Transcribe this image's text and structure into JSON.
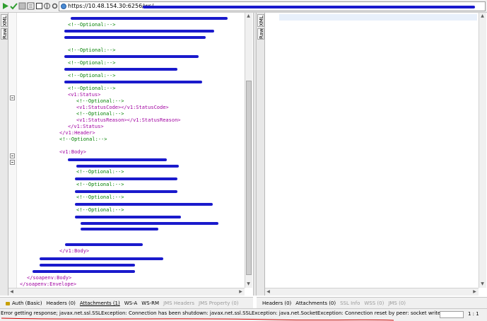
{
  "toolbar": {
    "url": "https://10.48.154.30:6256/ws/",
    "icons": [
      "play-icon",
      "green-check-icon",
      "stop-icon",
      "options-icon",
      "square-icon",
      "ws-icon",
      "settings-icon"
    ]
  },
  "left_panel": {
    "side_tabs": [
      "XML",
      "Raw"
    ],
    "code_lines": [
      {
        "text": "<!--Optional:-->",
        "kind": "comment"
      },
      {
        "text": "<!--Optional:-->",
        "kind": "comment"
      },
      {
        "text": "<!--Optional:-->",
        "kind": "comment"
      },
      {
        "text": "<!--Optional:-->",
        "kind": "comment"
      },
      {
        "text": "<!--Optional:-->",
        "kind": "comment"
      },
      {
        "text": "<v1:Status>",
        "kind": "tag"
      },
      {
        "text": "<!--Optional:-->",
        "kind": "comment"
      },
      {
        "text": "<v1:StatusCode></v1:StatusCode>",
        "kind": "tag"
      },
      {
        "text": "<!--Optional:-->",
        "kind": "comment"
      },
      {
        "text": "<v1:StatusReason></v1:StatusReason>",
        "kind": "tag"
      },
      {
        "text": "</v1:Status>",
        "kind": "tag"
      },
      {
        "text": "</v1:Header>",
        "kind": "tag"
      },
      {
        "text": "<!--Optional:-->",
        "kind": "comment"
      },
      {
        "text": "<v1:Body>",
        "kind": "tag"
      },
      {
        "text": "<!--Optional:-->",
        "kind": "comment"
      },
      {
        "text": "<!--Optional:-->",
        "kind": "comment"
      },
      {
        "text": "<!--Optional:-->",
        "kind": "comment"
      },
      {
        "text": "<!--Optional:-->",
        "kind": "comment"
      },
      {
        "text": "</v1:Body>",
        "kind": "tag"
      },
      {
        "text": "</soapenv:Body>",
        "kind": "tag"
      },
      {
        "text": "</soapenv:Envelope>",
        "kind": "tag"
      }
    ]
  },
  "right_panel": {
    "side_tabs": [
      "XML",
      "Raw"
    ]
  },
  "request_tabs": {
    "auth": "Auth (Basic)",
    "headers": "Headers (0)",
    "attachments": "Attachments (1)",
    "wsa": "WS-A",
    "wsrm": "WS-RM",
    "jms_headers": "JMS Headers",
    "jms_property": "JMS Property (0)"
  },
  "response_tabs": {
    "headers": "Headers (0)",
    "attachments": "Attachments (0)",
    "ssl_info": "SSL Info",
    "wss": "WSS (0)",
    "jms": "JMS (0)"
  },
  "status_bar": {
    "message": "Error getting response; javax.net.ssl.SSLException: Connection has been shutdown: javax.net.ssl.SSLException: java.net.SocketException: Connection reset by peer: socket write error",
    "position": "1 : 1",
    "underline_color": "#d40000"
  },
  "colors": {
    "redaction": "#1a1acc",
    "comment": "#008000",
    "tag": "#a000a0"
  }
}
